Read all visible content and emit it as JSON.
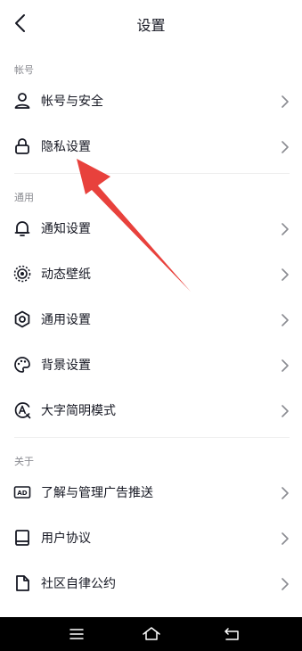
{
  "header": {
    "title": "设置"
  },
  "sections": [
    {
      "label": "帐号",
      "items": [
        {
          "label": "帐号与安全",
          "icon": "user-icon"
        },
        {
          "label": "隐私设置",
          "icon": "lock-icon"
        }
      ]
    },
    {
      "label": "通用",
      "items": [
        {
          "label": "通知设置",
          "icon": "bell-icon"
        },
        {
          "label": "动态壁纸",
          "icon": "live-wallpaper-icon"
        },
        {
          "label": "通用设置",
          "icon": "gear-icon"
        },
        {
          "label": "背景设置",
          "icon": "palette-icon"
        },
        {
          "label": "大字简明模式",
          "icon": "large-font-icon"
        }
      ]
    },
    {
      "label": "关于",
      "items": [
        {
          "label": "了解与管理广告推送",
          "icon": "ad-icon"
        },
        {
          "label": "用户协议",
          "icon": "book-icon"
        },
        {
          "label": "社区自律公约",
          "icon": "document-icon"
        }
      ]
    }
  ],
  "colors": {
    "annotation_arrow": "#e8413c",
    "text": "#161823",
    "muted": "#8a8b91"
  }
}
